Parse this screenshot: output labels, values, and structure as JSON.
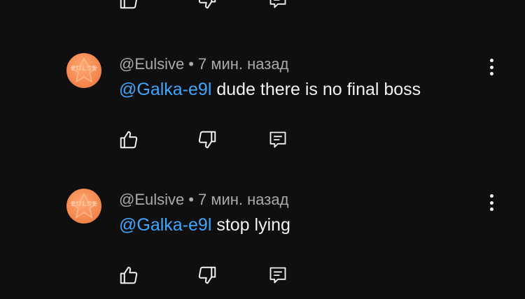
{
  "colors": {
    "background": "#0f0f0f",
    "text": "#f1f1f1",
    "meta": "#aaaaaa",
    "mention": "#3ea6ff",
    "avatar": "#f4874f"
  },
  "actions": {
    "like_icon": "thumbs-up-icon",
    "dislike_icon": "thumbs-down-icon",
    "reply_icon": "reply-comment-icon"
  },
  "comments": [
    {
      "avatar_text": "EULSE",
      "author": "@Eulsive",
      "separator": "•",
      "time": "7 мин. назад",
      "mention": "@Galka-e9l",
      "text": "dude there is no final boss",
      "menu_icon": "more-vert-icon"
    },
    {
      "avatar_text": "EULSE",
      "author": "@Eulsive",
      "separator": "•",
      "time": "7 мин. назад",
      "mention": "@Galka-e9l",
      "text": "stop lying",
      "menu_icon": "more-vert-icon"
    }
  ]
}
